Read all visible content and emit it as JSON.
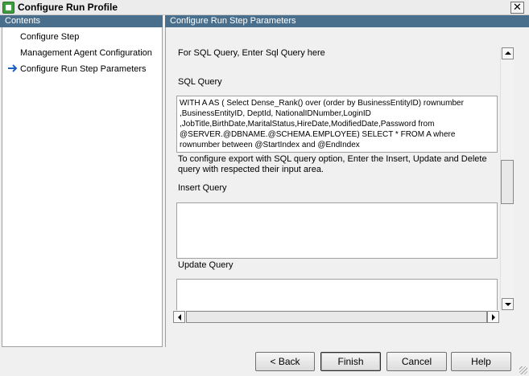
{
  "window": {
    "title": "Configure Run Profile",
    "close_glyph": "✕"
  },
  "left": {
    "header": "Contents",
    "items": [
      {
        "label": "Configure Step"
      },
      {
        "label": "Management Agent Configuration"
      },
      {
        "label": "Configure Run Step Parameters",
        "selected": true
      }
    ]
  },
  "right": {
    "header": "Configure Run Step Parameters",
    "sql_hint": "For SQL Query, Enter Sql Query here",
    "sql_label": "SQL Query",
    "sql_value": "WITH A AS ( Select Dense_Rank() over (order by  BusinessEntityID) rownumber ,BusinessEntityID, DeptId, NationalIDNumber,LoginID ,JobTitle,BirthDate,MaritalStatus,HireDate,ModifiedDate,Password from @SERVER.@DBNAME.@SCHEMA.EMPLOYEE) SELECT * FROM  A     where rownumber between @StartIndex and @EndIndex",
    "export_note": "To configure export with SQL query option, Enter the Insert, Update and Delete query with respected their input area.",
    "insert_label": "Insert Query",
    "insert_value": "",
    "update_label": "Update Query",
    "update_value": ""
  },
  "buttons": {
    "back": "< Back",
    "finish": "Finish",
    "cancel": "Cancel",
    "help": "Help"
  },
  "colors": {
    "header_bg": "#4a6f8c",
    "arrow": "#1f5fbf"
  }
}
